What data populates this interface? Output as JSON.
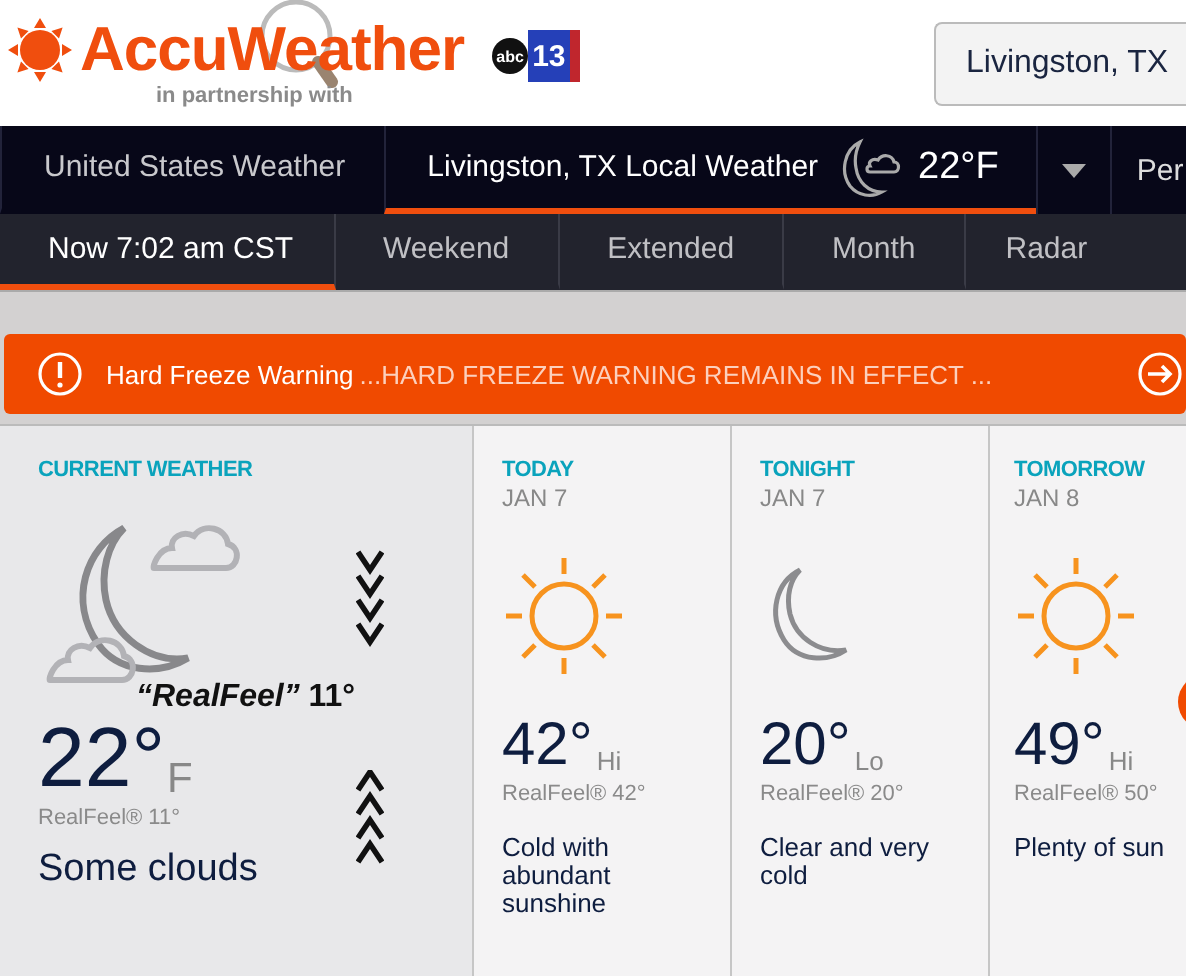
{
  "header": {
    "logo": "AccuWeather",
    "partner_text": "in partnership with",
    "partner_logo": {
      "network": "abc",
      "channel": "13"
    },
    "location_button": "Livingston, TX"
  },
  "nav": {
    "items": [
      {
        "label": "United States Weather",
        "selected": false
      },
      {
        "label": "Livingston, TX Local Weather",
        "selected": true,
        "temp": "22°F"
      }
    ],
    "more": "Per"
  },
  "subnav": [
    {
      "label": "Now 7:02 am CST",
      "selected": true
    },
    {
      "label": "Weekend",
      "selected": false
    },
    {
      "label": "Extended",
      "selected": false
    },
    {
      "label": "Month",
      "selected": false
    },
    {
      "label": "Radar",
      "selected": false
    }
  ],
  "alert": {
    "title": "Hard Freeze Warning",
    "text": "...HARD FREEZE WARNING REMAINS IN EFFECT ..."
  },
  "current": {
    "heading": "CURRENT WEATHER",
    "kind": "moon-clouds",
    "temp": "22°",
    "unit": "F",
    "realfeel": "RealFeel® 11°",
    "phrase": "Some clouds",
    "annotation": "*“RealFeel”* 11°"
  },
  "forecast": [
    {
      "heading": "TODAY",
      "date": "JAN 7",
      "kind": "sun",
      "temp": "42°",
      "hilo": "Hi",
      "realfeel": "RealFeel® 42°",
      "phrase": "Cold with abundant sunshine"
    },
    {
      "heading": "TONIGHT",
      "date": "JAN 7",
      "kind": "moon",
      "temp": "20°",
      "hilo": "Lo",
      "realfeel": "RealFeel® 20°",
      "phrase": "Clear and very cold"
    },
    {
      "heading": "TOMORROW",
      "date": "JAN 8",
      "kind": "sun",
      "temp": "49°",
      "hilo": "Hi",
      "realfeel": "RealFeel® 50°",
      "phrase": "Plenty of sun"
    }
  ]
}
